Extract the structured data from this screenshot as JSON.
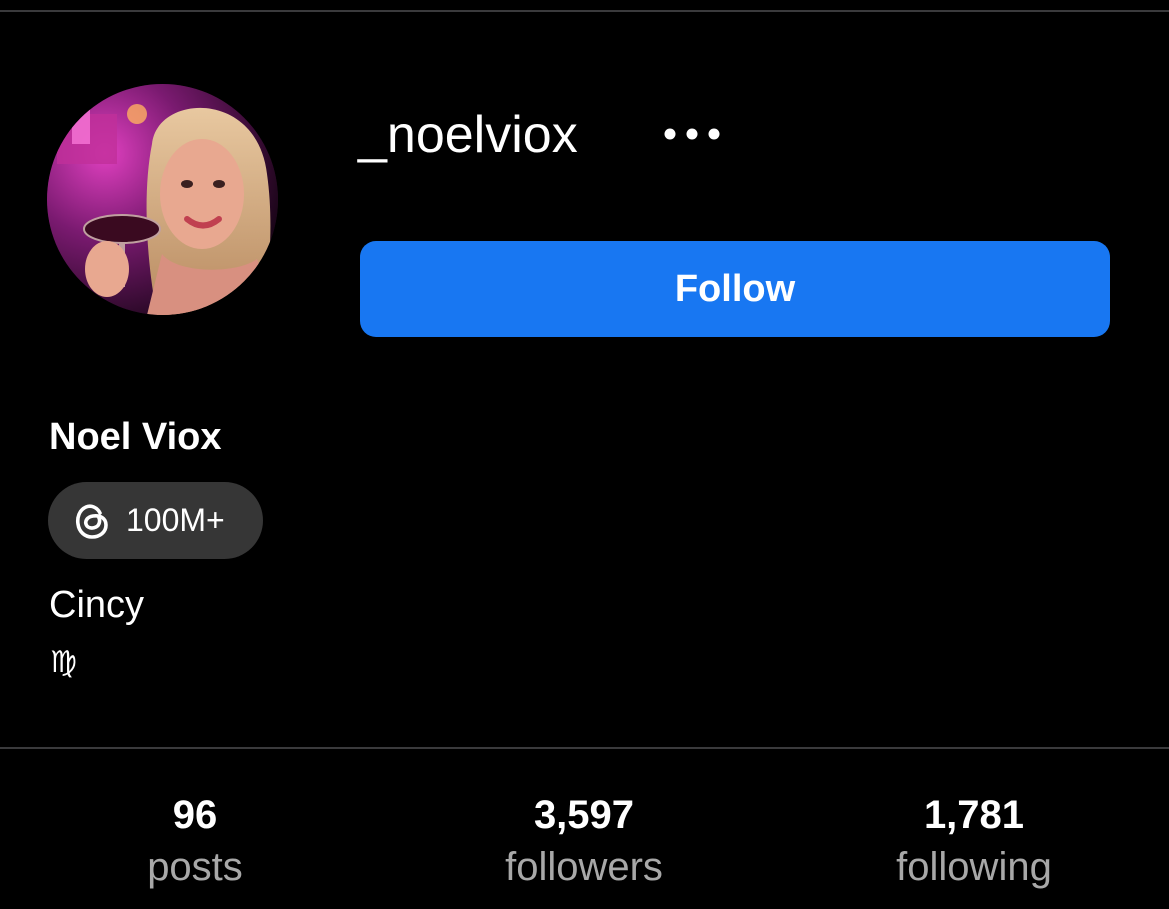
{
  "profile": {
    "username": "_noelviox",
    "display_name": "Noel Viox",
    "follow_label": "Follow",
    "threads_badge": {
      "icon": "threads-icon",
      "count": "100M+"
    },
    "bio": {
      "line1": "Cincy",
      "line2": "♍"
    },
    "avatar_icon": "profile-photo"
  },
  "stats": [
    {
      "value": "96",
      "label": "posts"
    },
    {
      "value": "3,597",
      "label": "followers"
    },
    {
      "value": "1,781",
      "label": "following"
    }
  ],
  "colors": {
    "background": "#000000",
    "follow_button": "#1877f2",
    "badge_bg": "#363636",
    "secondary_text": "#a8a8a8",
    "divider": "#3a3a3c"
  }
}
